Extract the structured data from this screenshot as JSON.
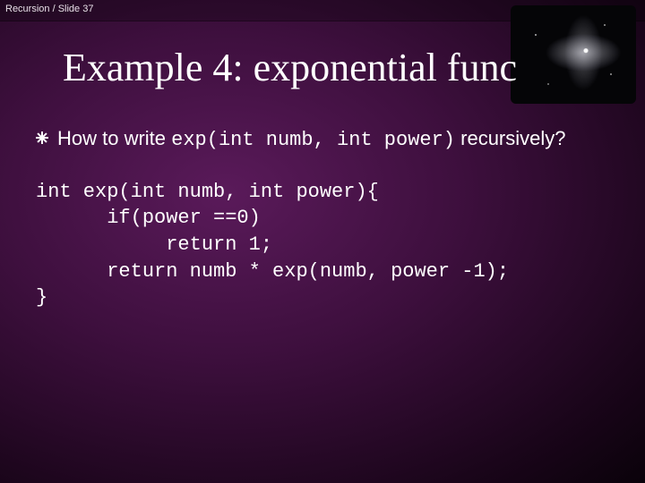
{
  "header": {
    "path": "Recursion / Slide 37"
  },
  "title": "Example 4: exponential func",
  "bullet": {
    "pre": "How to write ",
    "code": "exp(int numb, int power)",
    "post": " recursively?"
  },
  "code": "int exp(int numb, int power){\n      if(power ==0)\n           return 1;\n      return numb * exp(numb, power -1);\n}"
}
